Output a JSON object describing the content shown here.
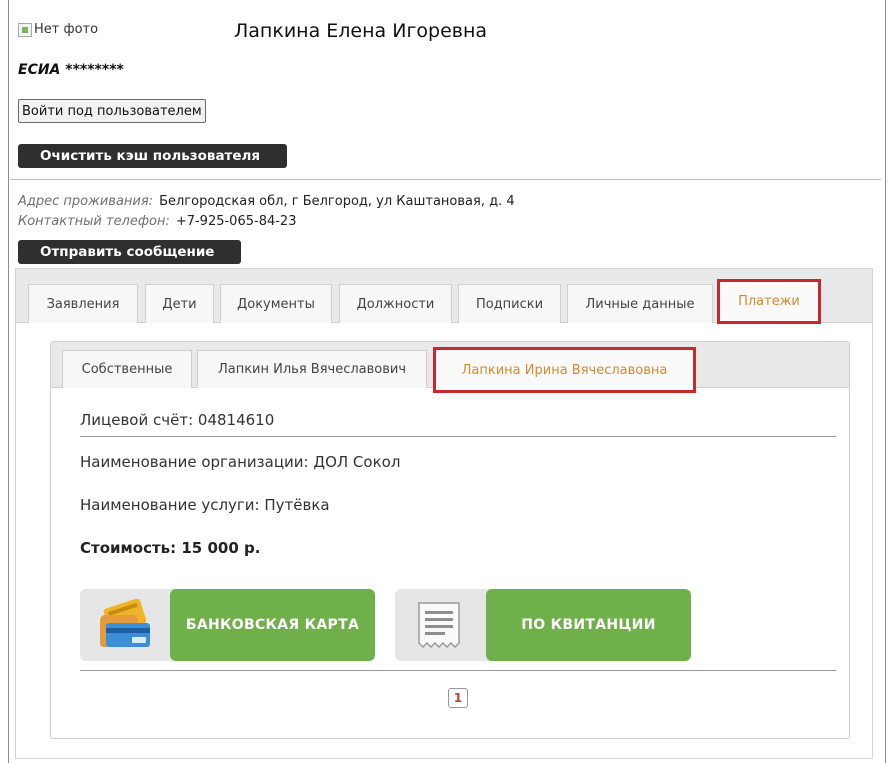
{
  "profile": {
    "photo_alt": "Нет фото",
    "full_name": "Лапкина Елена Игоревна",
    "esia_label": "ЕСИА",
    "esia_value": "********",
    "login_as_user_label": "Войти под пользователем",
    "clear_cache_label": "Очистить кэш пользователя",
    "address_label": "Адрес проживания:",
    "address_value": "Белгородская обл, г Белгород, ул Каштановая, д. 4",
    "phone_label": "Контактный телефон:",
    "phone_value": "+7-925-065-84-23",
    "send_message_label": "Отправить сообщение"
  },
  "tabs": [
    {
      "label": "Заявления"
    },
    {
      "label": "Дети"
    },
    {
      "label": "Документы"
    },
    {
      "label": "Должности"
    },
    {
      "label": "Подписки"
    },
    {
      "label": "Личные данные"
    },
    {
      "label": "Платежи",
      "active": true
    }
  ],
  "payments": {
    "subtabs": [
      {
        "label": "Собственные"
      },
      {
        "label": "Лапкин Илья Вячеславович"
      },
      {
        "label": "Лапкина Ирина Вячеславовна",
        "active": true
      }
    ],
    "account": "Лицевой счёт: 04814610",
    "organization": "Наименование организации: ДОЛ Сокол",
    "service": "Наименование услуги: Путёвка",
    "cost": "Стоимость: 15 000 р.",
    "pay_card_label": "БАНКОВСКАЯ КАРТА",
    "pay_card_icon": "credit-card-icon",
    "pay_receipt_label": "ПО КВИТАНЦИИ",
    "pay_receipt_icon": "receipt-icon",
    "page_current": "1"
  },
  "colors": {
    "highlight_border": "#c9282d",
    "active_tab_text": "#d58a2b",
    "pay_button": "#6fb04b",
    "dark_button": "#2f2f2f"
  }
}
